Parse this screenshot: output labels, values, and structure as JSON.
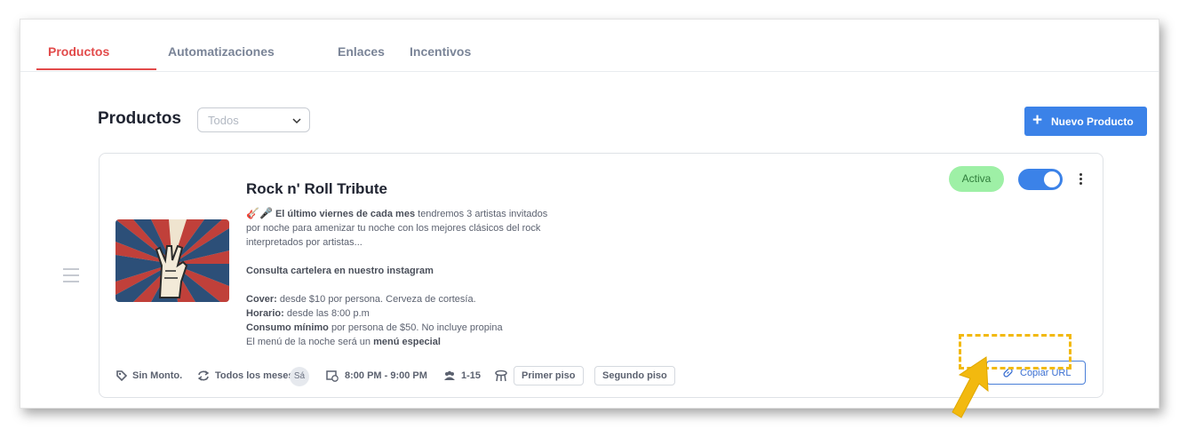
{
  "tabs": [
    {
      "label": "Productos",
      "active": true
    },
    {
      "label": "Automatizaciones",
      "active": false
    },
    {
      "label": "Enlaces",
      "active": false
    },
    {
      "label": "Incentivos",
      "active": false
    }
  ],
  "page": {
    "title": "Productos",
    "filter": {
      "value": "Todos"
    },
    "new_button": "Nuevo Producto"
  },
  "product": {
    "title": "Rock n' Roll Tribute",
    "emojis": "🎸🎤",
    "desc_bold_1": "El último viernes de cada mes",
    "desc_text_1": " tendremos 3 artistas invitados por noche para amenizar tu noche con los mejores clásicos del rock interpretados por artistas...",
    "desc_line_2": "Consulta cartelera en nuestro instagram",
    "cover_label": "Cover:",
    "cover_text": " desde $10 por persona. Cerveza de cortesía.",
    "horario_label": "Horario:",
    "horario_text": " desde las 8:00 p.m",
    "consumo_label": "Consumo mínimo",
    "consumo_text": " por persona de $50. No incluye propina",
    "menu_text": "El menú de la noche será un ",
    "menu_bold": "menú especial",
    "status": "Activa",
    "enabled": true,
    "price": "Sin Monto.",
    "recurrence": "Todos los meses",
    "day": "Sá",
    "time": "8:00 PM - 9:00 PM",
    "capacity": "1-15",
    "areas": [
      "Primer piso",
      "Segundo piso"
    ],
    "copy_button": "Copiar URL"
  },
  "colors": {
    "accent": "#e24b4b",
    "primary": "#3b82e8",
    "active_badge": "#9ef0a6",
    "highlight": "#f2b90f"
  }
}
